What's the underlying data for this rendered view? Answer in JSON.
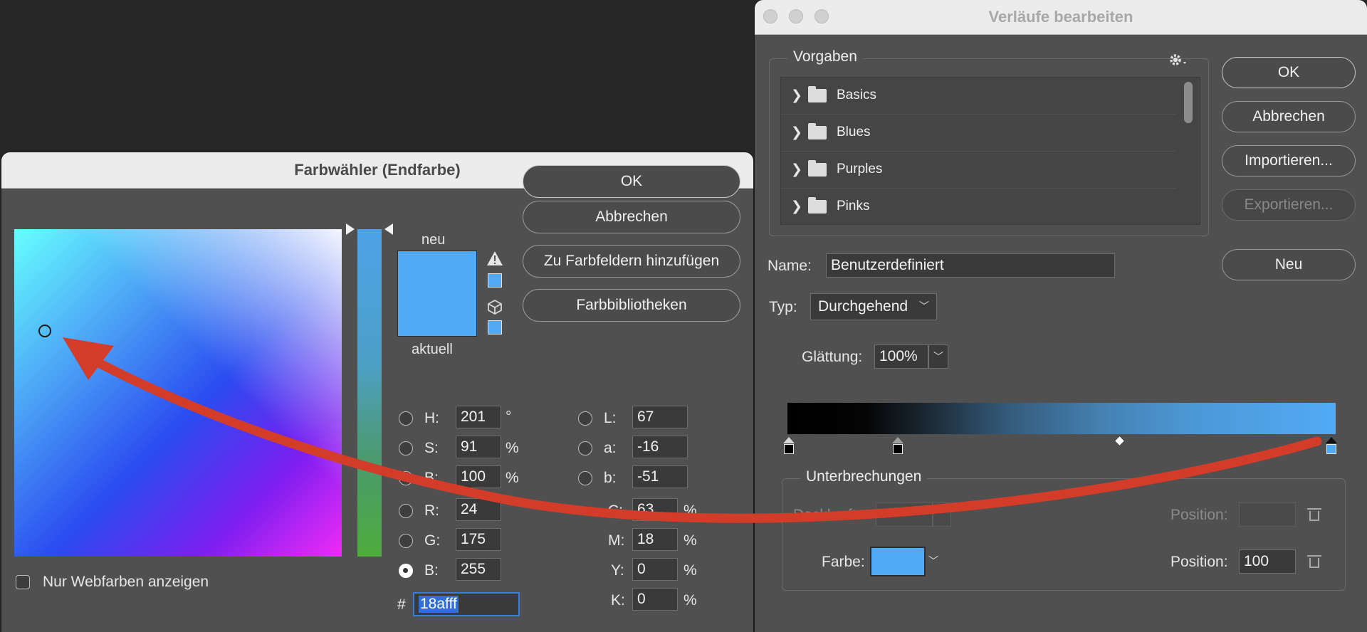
{
  "picker": {
    "title": "Farbwähler (Endfarbe)",
    "ok_label": "OK",
    "cancel_label": "Abbrechen",
    "add_swatch_label": "Zu Farbfeldern hinzufügen",
    "libraries_label": "Farbbibliotheken",
    "new_label": "neu",
    "current_label": "aktuell",
    "web_colors_label": "Nur Webfarben anzeigen",
    "swatch_color": "#52aaf5",
    "hsb": {
      "h_label": "H:",
      "h_value": "201",
      "h_unit": "°",
      "s_label": "S:",
      "s_value": "91",
      "s_unit": "%",
      "b_label": "B:",
      "b_value": "100",
      "b_unit": "%"
    },
    "rgb": {
      "r_label": "R:",
      "r_value": "24",
      "g_label": "G:",
      "g_value": "175",
      "b_label": "B:",
      "b_value": "255"
    },
    "lab": {
      "l_label": "L:",
      "l_value": "67",
      "a_label": "a:",
      "a_value": "-16",
      "b_label": "b:",
      "b_value": "-51"
    },
    "cmyk": {
      "c_label": "C:",
      "c_value": "63",
      "c_unit": "%",
      "m_label": "M:",
      "m_value": "18",
      "m_unit": "%",
      "y_label": "Y:",
      "y_value": "0",
      "y_unit": "%",
      "k_label": "K:",
      "k_value": "0",
      "k_unit": "%"
    },
    "hex_label": "#",
    "hex_value": "18afff"
  },
  "gradient_editor": {
    "title": "Verläufe bearbeiten",
    "presets_title": "Vorgaben",
    "presets": [
      "Basics",
      "Blues",
      "Purples",
      "Pinks"
    ],
    "ok_label": "OK",
    "cancel_label": "Abbrechen",
    "import_label": "Importieren...",
    "export_label": "Exportieren...",
    "new_label": "Neu",
    "name_label": "Name:",
    "name_value": "Benutzerdefiniert",
    "type_label": "Typ:",
    "type_value": "Durchgehend",
    "smoothness_label": "Glättung:",
    "smoothness_value": "100%",
    "stops_title": "Unterbrechungen",
    "opacity_label": "Deckkraft:",
    "opacity_position_label": "Position:",
    "color_label": "Farbe:",
    "color_position_label": "Position:",
    "color_position_value": "100",
    "stop_color": "#52aaf5"
  },
  "annotation": {
    "arrow_color": "#d43c2a"
  }
}
